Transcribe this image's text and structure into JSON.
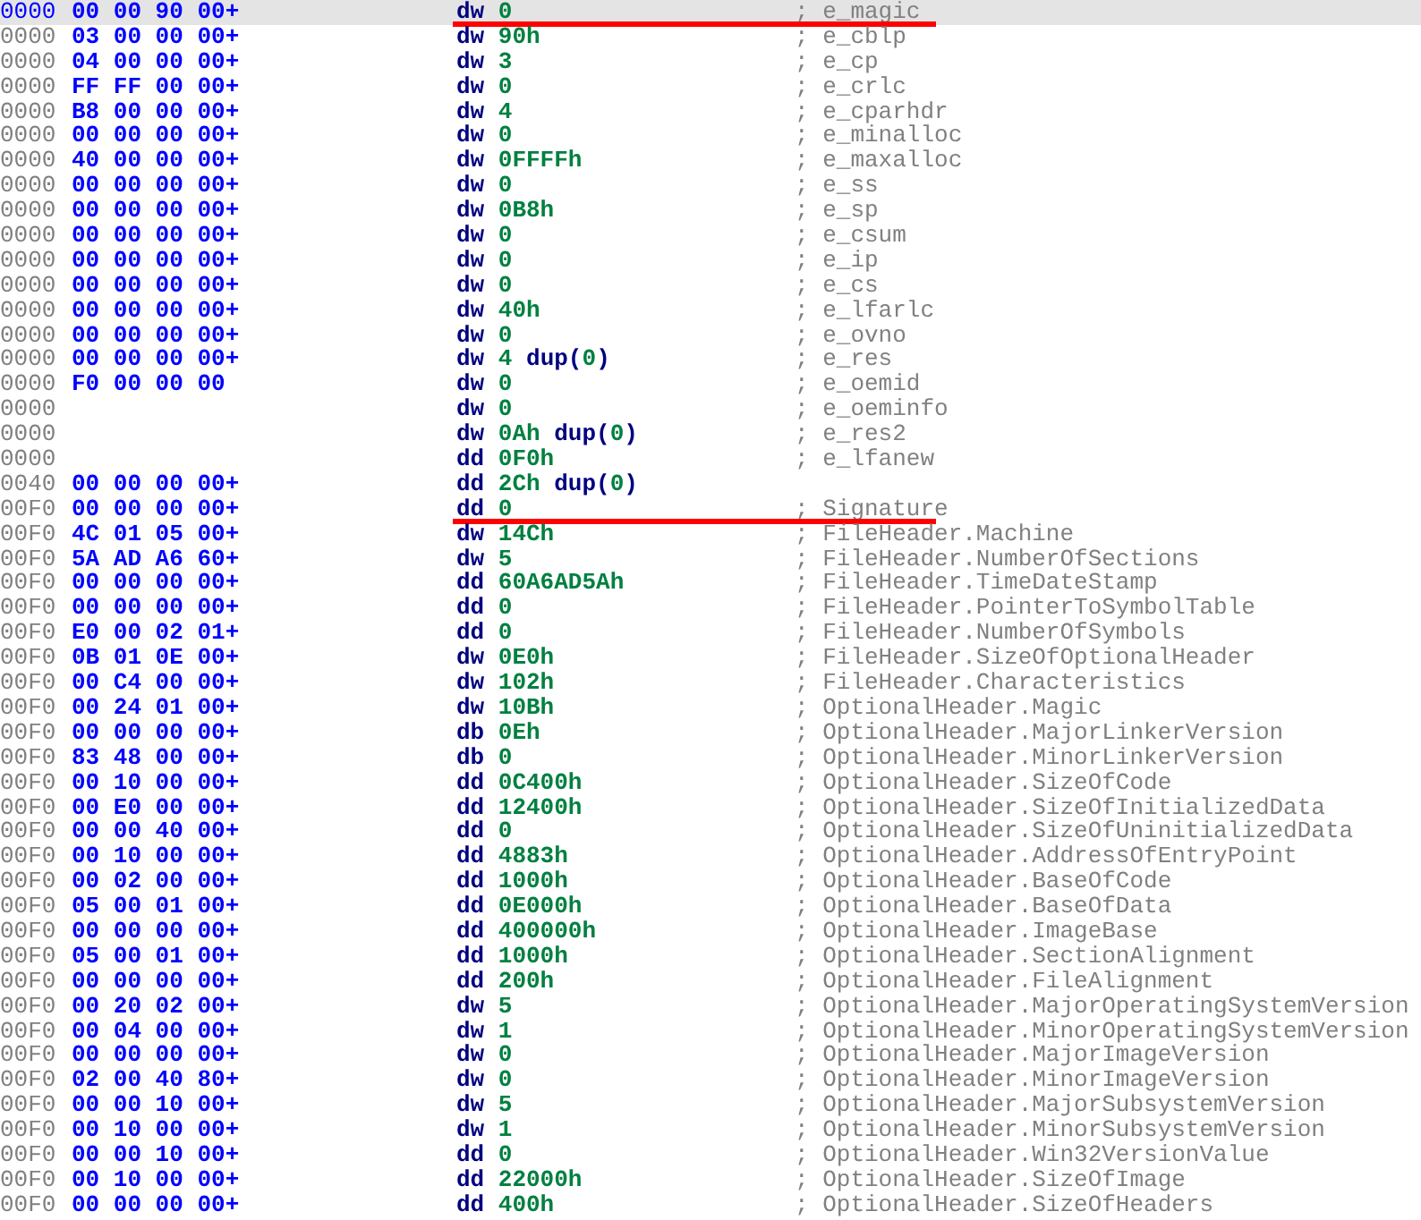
{
  "listing": {
    "rows": [
      {
        "address": "0000",
        "bytes": "00 00 90 00+",
        "directive": "dw",
        "operand": "0",
        "comment": "; e_magic",
        "selected": true,
        "marked": true
      },
      {
        "address": "0000",
        "bytes": "03 00 00 00+",
        "directive": "dw",
        "operand": "90h",
        "comment": "; e_cblp",
        "selected": false,
        "marked": false
      },
      {
        "address": "0000",
        "bytes": "04 00 00 00+",
        "directive": "dw",
        "operand": "3",
        "comment": "; e_cp",
        "selected": false,
        "marked": false
      },
      {
        "address": "0000",
        "bytes": "FF FF 00 00+",
        "directive": "dw",
        "operand": "0",
        "comment": "; e_crlc",
        "selected": false,
        "marked": false
      },
      {
        "address": "0000",
        "bytes": "B8 00 00 00+",
        "directive": "dw",
        "operand": "4",
        "comment": "; e_cparhdr",
        "selected": false,
        "marked": false
      },
      {
        "address": "0000",
        "bytes": "00 00 00 00+",
        "directive": "dw",
        "operand": "0",
        "comment": "; e_minalloc",
        "selected": false,
        "marked": false
      },
      {
        "address": "0000",
        "bytes": "40 00 00 00+",
        "directive": "dw",
        "operand": "0FFFFh",
        "comment": "; e_maxalloc",
        "selected": false,
        "marked": false
      },
      {
        "address": "0000",
        "bytes": "00 00 00 00+",
        "directive": "dw",
        "operand": "0",
        "comment": "; e_ss",
        "selected": false,
        "marked": false
      },
      {
        "address": "0000",
        "bytes": "00 00 00 00+",
        "directive": "dw",
        "operand": "0B8h",
        "comment": "; e_sp",
        "selected": false,
        "marked": false
      },
      {
        "address": "0000",
        "bytes": "00 00 00 00+",
        "directive": "dw",
        "operand": "0",
        "comment": "; e_csum",
        "selected": false,
        "marked": false
      },
      {
        "address": "0000",
        "bytes": "00 00 00 00+",
        "directive": "dw",
        "operand": "0",
        "comment": "; e_ip",
        "selected": false,
        "marked": false
      },
      {
        "address": "0000",
        "bytes": "00 00 00 00+",
        "directive": "dw",
        "operand": "0",
        "comment": "; e_cs",
        "selected": false,
        "marked": false
      },
      {
        "address": "0000",
        "bytes": "00 00 00 00+",
        "directive": "dw",
        "operand": "40h",
        "comment": "; e_lfarlc",
        "selected": false,
        "marked": false
      },
      {
        "address": "0000",
        "bytes": "00 00 00 00+",
        "directive": "dw",
        "operand": "0",
        "comment": "; e_ovno",
        "selected": false,
        "marked": false
      },
      {
        "address": "0000",
        "bytes": "00 00 00 00+",
        "directive": "dw",
        "operand": "4",
        "dup": {
          "keyword": "dup",
          "open": "(",
          "value": "0",
          "close": ")"
        },
        "comment": "; e_res",
        "selected": false,
        "marked": false
      },
      {
        "address": "0000",
        "bytes": "F0 00 00 00",
        "directive": "dw",
        "operand": "0",
        "comment": "; e_oemid",
        "selected": false,
        "marked": false
      },
      {
        "address": "0000",
        "directive": "dw",
        "operand": "0",
        "comment": "; e_oeminfo",
        "selected": false,
        "marked": false
      },
      {
        "address": "0000",
        "directive": "dw",
        "operand": "0Ah",
        "dup": {
          "keyword": "dup",
          "open": "(",
          "value": "0",
          "close": ")"
        },
        "comment": "; e_res2",
        "selected": false,
        "marked": false
      },
      {
        "address": "0000",
        "directive": "dd",
        "operand": "0F0h",
        "comment": "; e_lfanew",
        "selected": false,
        "marked": false
      },
      {
        "address": "0040",
        "bytes": "00 00 00 00+",
        "directive": "dd",
        "operand": "2Ch",
        "dup": {
          "keyword": "dup",
          "open": "(",
          "value": "0",
          "close": ")"
        },
        "selected": false,
        "marked": false
      },
      {
        "address": "00F0",
        "bytes": "00 00 00 00+",
        "directive": "dd",
        "operand": "0",
        "comment": "; Signature",
        "selected": false,
        "marked": true
      },
      {
        "address": "00F0",
        "bytes": "4C 01 05 00+",
        "directive": "dw",
        "operand": "14Ch",
        "comment": "; FileHeader.Machine",
        "selected": false,
        "marked": false
      },
      {
        "address": "00F0",
        "bytes": "5A AD A6 60+",
        "directive": "dw",
        "operand": "5",
        "comment": "; FileHeader.NumberOfSections",
        "selected": false,
        "marked": false
      },
      {
        "address": "00F0",
        "bytes": "00 00 00 00+",
        "directive": "dd",
        "operand": "60A6AD5Ah",
        "comment": "; FileHeader.TimeDateStamp",
        "selected": false,
        "marked": false
      },
      {
        "address": "00F0",
        "bytes": "00 00 00 00+",
        "directive": "dd",
        "operand": "0",
        "comment": "; FileHeader.PointerToSymbolTable",
        "selected": false,
        "marked": false
      },
      {
        "address": "00F0",
        "bytes": "E0 00 02 01+",
        "directive": "dd",
        "operand": "0",
        "comment": "; FileHeader.NumberOfSymbols",
        "selected": false,
        "marked": false
      },
      {
        "address": "00F0",
        "bytes": "0B 01 0E 00+",
        "directive": "dw",
        "operand": "0E0h",
        "comment": "; FileHeader.SizeOfOptionalHeader",
        "selected": false,
        "marked": false
      },
      {
        "address": "00F0",
        "bytes": "00 C4 00 00+",
        "directive": "dw",
        "operand": "102h",
        "comment": "; FileHeader.Characteristics",
        "selected": false,
        "marked": false
      },
      {
        "address": "00F0",
        "bytes": "00 24 01 00+",
        "directive": "dw",
        "operand": "10Bh",
        "comment": "; OptionalHeader.Magic",
        "selected": false,
        "marked": false
      },
      {
        "address": "00F0",
        "bytes": "00 00 00 00+",
        "directive": "db",
        "operand": "0Eh",
        "comment": "; OptionalHeader.MajorLinkerVersion",
        "selected": false,
        "marked": false
      },
      {
        "address": "00F0",
        "bytes": "83 48 00 00+",
        "directive": "db",
        "operand": "0",
        "comment": "; OptionalHeader.MinorLinkerVersion",
        "selected": false,
        "marked": false
      },
      {
        "address": "00F0",
        "bytes": "00 10 00 00+",
        "directive": "dd",
        "operand": "0C400h",
        "comment": "; OptionalHeader.SizeOfCode",
        "selected": false,
        "marked": false
      },
      {
        "address": "00F0",
        "bytes": "00 E0 00 00+",
        "directive": "dd",
        "operand": "12400h",
        "comment": "; OptionalHeader.SizeOfInitializedData",
        "selected": false,
        "marked": false
      },
      {
        "address": "00F0",
        "bytes": "00 00 40 00+",
        "directive": "dd",
        "operand": "0",
        "comment": "; OptionalHeader.SizeOfUninitializedData",
        "selected": false,
        "marked": false
      },
      {
        "address": "00F0",
        "bytes": "00 10 00 00+",
        "directive": "dd",
        "operand": "4883h",
        "comment": "; OptionalHeader.AddressOfEntryPoint",
        "selected": false,
        "marked": false
      },
      {
        "address": "00F0",
        "bytes": "00 02 00 00+",
        "directive": "dd",
        "operand": "1000h",
        "comment": "; OptionalHeader.BaseOfCode",
        "selected": false,
        "marked": false
      },
      {
        "address": "00F0",
        "bytes": "05 00 01 00+",
        "directive": "dd",
        "operand": "0E000h",
        "comment": "; OptionalHeader.BaseOfData",
        "selected": false,
        "marked": false
      },
      {
        "address": "00F0",
        "bytes": "00 00 00 00+",
        "directive": "dd",
        "operand": "400000h",
        "comment": "; OptionalHeader.ImageBase",
        "selected": false,
        "marked": false
      },
      {
        "address": "00F0",
        "bytes": "05 00 01 00+",
        "directive": "dd",
        "operand": "1000h",
        "comment": "; OptionalHeader.SectionAlignment",
        "selected": false,
        "marked": false
      },
      {
        "address": "00F0",
        "bytes": "00 00 00 00+",
        "directive": "dd",
        "operand": "200h",
        "comment": "; OptionalHeader.FileAlignment",
        "selected": false,
        "marked": false
      },
      {
        "address": "00F0",
        "bytes": "00 20 02 00+",
        "directive": "dw",
        "operand": "5",
        "comment": "; OptionalHeader.MajorOperatingSystemVersion",
        "selected": false,
        "marked": false
      },
      {
        "address": "00F0",
        "bytes": "00 04 00 00+",
        "directive": "dw",
        "operand": "1",
        "comment": "; OptionalHeader.MinorOperatingSystemVersion",
        "selected": false,
        "marked": false
      },
      {
        "address": "00F0",
        "bytes": "00 00 00 00+",
        "directive": "dw",
        "operand": "0",
        "comment": "; OptionalHeader.MajorImageVersion",
        "selected": false,
        "marked": false
      },
      {
        "address": "00F0",
        "bytes": "02 00 40 80+",
        "directive": "dw",
        "operand": "0",
        "comment": "; OptionalHeader.MinorImageVersion",
        "selected": false,
        "marked": false
      },
      {
        "address": "00F0",
        "bytes": "00 00 10 00+",
        "directive": "dw",
        "operand": "5",
        "comment": "; OptionalHeader.MajorSubsystemVersion",
        "selected": false,
        "marked": false
      },
      {
        "address": "00F0",
        "bytes": "00 10 00 00+",
        "directive": "dw",
        "operand": "1",
        "comment": "; OptionalHeader.MinorSubsystemVersion",
        "selected": false,
        "marked": false
      },
      {
        "address": "00F0",
        "bytes": "00 00 10 00+",
        "directive": "dd",
        "operand": "0",
        "comment": "; OptionalHeader.Win32VersionValue",
        "selected": false,
        "marked": false
      },
      {
        "address": "00F0",
        "bytes": "00 10 00 00+",
        "directive": "dd",
        "operand": "22000h",
        "comment": "; OptionalHeader.SizeOfImage",
        "selected": false,
        "marked": false
      },
      {
        "address": "00F0",
        "bytes": "00 00 00 00+",
        "directive": "dd",
        "operand": "400h",
        "comment": "; OptionalHeader.SizeOfHeaders",
        "selected": false,
        "marked": false
      }
    ]
  }
}
